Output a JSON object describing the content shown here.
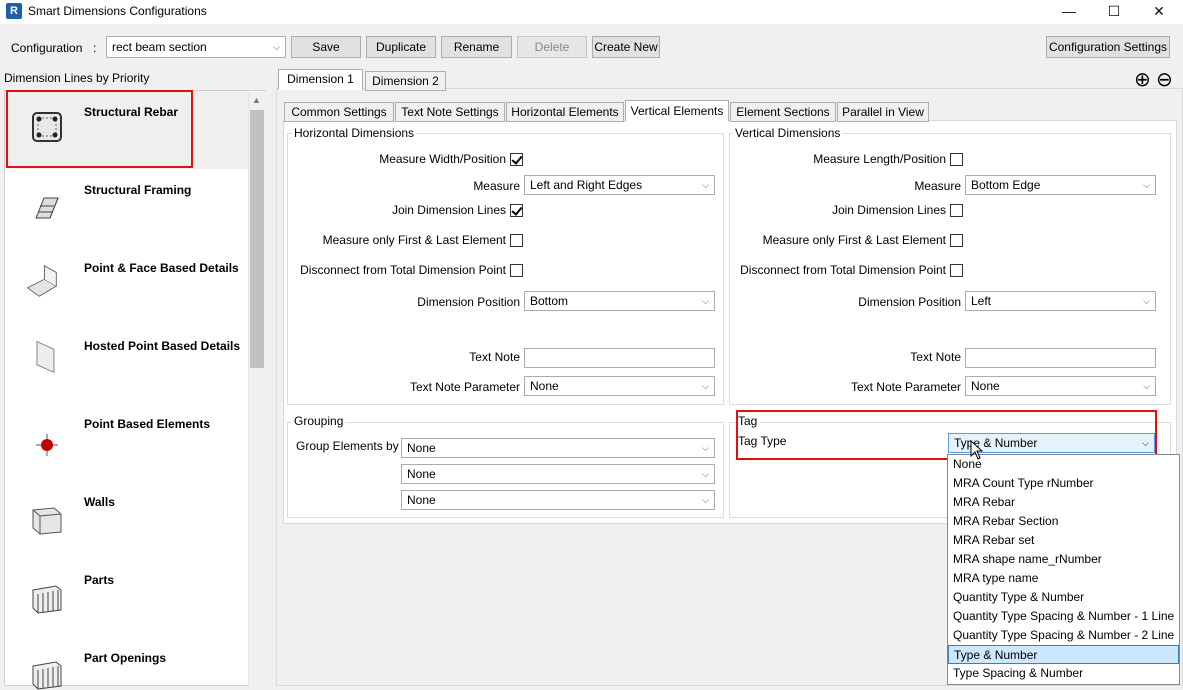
{
  "window": {
    "title": "Smart Dimensions Configurations",
    "app_icon": "R",
    "minimize": "—",
    "maximize": "☐",
    "close": "✕"
  },
  "toolbar": {
    "config_label": "Configuration",
    "config_sep": ":",
    "config_value": "rect beam section",
    "save": "Save",
    "duplicate": "Duplicate",
    "rename": "Rename",
    "delete": "Delete",
    "create_new": "Create New",
    "config_settings": "Configuration Settings"
  },
  "left": {
    "title": "Dimension Lines by Priority",
    "items": [
      {
        "label": "Structural Rebar",
        "icon": "rebar-icon"
      },
      {
        "label": "Structural Framing",
        "icon": "beam-icon"
      },
      {
        "label": "Point & Face Based Details",
        "icon": "face-detail-icon"
      },
      {
        "label": "Hosted Point Based Details",
        "icon": "panel-icon"
      },
      {
        "label": "Point Based Elements",
        "icon": "point-icon"
      },
      {
        "label": "Walls",
        "icon": "wall-icon"
      },
      {
        "label": "Parts",
        "icon": "parts-icon"
      },
      {
        "label": "Part Openings",
        "icon": "parts-icon"
      }
    ]
  },
  "dim_tabs": [
    "Dimension 1",
    "Dimension 2"
  ],
  "add_icon": "⊕",
  "remove_icon": "⊖",
  "sub_tabs": [
    "Common Settings",
    "Text Note Settings",
    "Horizontal Elements",
    "Vertical Elements",
    "Element Sections",
    "Parallel in View"
  ],
  "horiz": {
    "title": "Horizontal Dimensions",
    "measure_width": "Measure Width/Position",
    "measure_width_checked": true,
    "measure": "Measure",
    "measure_value": "Left and Right Edges",
    "join": "Join Dimension Lines",
    "join_checked": true,
    "first_last": "Measure only First & Last Element",
    "first_last_checked": false,
    "disconnect": "Disconnect from Total Dimension Point",
    "disconnect_checked": false,
    "position": "Dimension Position",
    "position_value": "Bottom",
    "text_note": "Text Note",
    "text_note_value": "",
    "text_param": "Text Note Parameter",
    "text_param_value": "None"
  },
  "vert": {
    "title": "Vertical Dimensions",
    "measure_length": "Measure Length/Position",
    "measure_length_checked": false,
    "measure": "Measure",
    "measure_value": "Bottom Edge",
    "join": "Join Dimension Lines",
    "join_checked": false,
    "first_last": "Measure only First & Last Element",
    "first_last_checked": false,
    "disconnect": "Disconnect from Total Dimension Point",
    "disconnect_checked": false,
    "position": "Dimension Position",
    "position_value": "Left",
    "text_note": "Text Note",
    "text_note_value": "",
    "text_param": "Text Note Parameter",
    "text_param_value": "None"
  },
  "grouping": {
    "title": "Grouping",
    "label": "Group Elements by",
    "values": [
      "None",
      "None",
      "None"
    ]
  },
  "tag": {
    "title": "Tag",
    "type_label": "Tag Type",
    "type_value": "Type & Number",
    "options": [
      "None",
      "MRA Count Type rNumber",
      "MRA Rebar",
      "MRA Rebar Section",
      "MRA Rebar set",
      "MRA shape name_rNumber",
      "MRA type name",
      "Quantity Type & Number",
      "Quantity Type Spacing & Number - 1 Line",
      "Quantity Type Spacing & Number - 2 Line",
      "Type & Number",
      "Type Spacing & Number"
    ],
    "selected_index": 10
  },
  "colors": {
    "highlight": "#e01010",
    "selection": "#cce8ff",
    "accent": "#1f5ea8"
  }
}
